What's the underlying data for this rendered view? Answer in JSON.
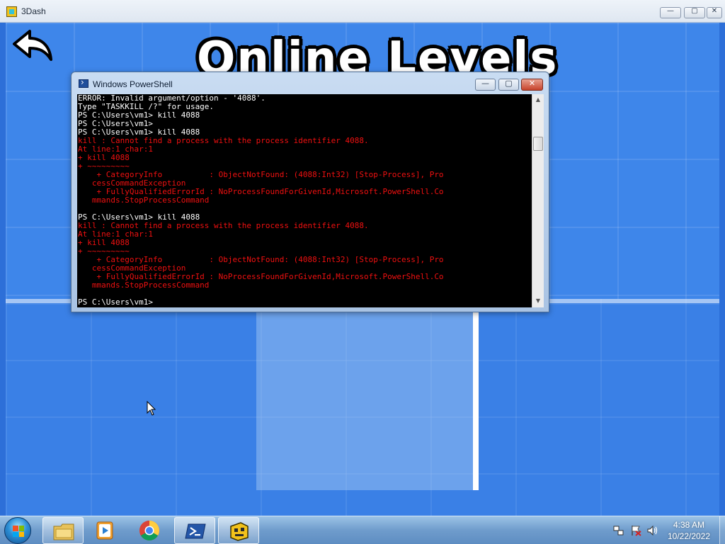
{
  "game": {
    "window_title": "3Dash",
    "heading": "Online Levels",
    "controls": {
      "minimize": "—",
      "maximize": "▢",
      "close": "✕"
    }
  },
  "powershell": {
    "title": "Windows PowerShell",
    "controls": {
      "minimize": "—",
      "maximize": "▢",
      "close": "✕"
    },
    "lines": [
      {
        "text": "ERROR: Invalid argument/option - '4088'.",
        "style": "normal"
      },
      {
        "text": "Type \"TASKKILL /?\" for usage.",
        "style": "normal"
      },
      {
        "text": "PS C:\\Users\\vm1> kill 4088",
        "style": "normal"
      },
      {
        "text": "PS C:\\Users\\vm1>",
        "style": "normal"
      },
      {
        "text": "PS C:\\Users\\vm1> kill 4088",
        "style": "normal"
      },
      {
        "text": "kill : Cannot find a process with the process identifier 4088.",
        "style": "error"
      },
      {
        "text": "At line:1 char:1",
        "style": "error"
      },
      {
        "text": "+ kill 4088",
        "style": "error"
      },
      {
        "text": "+ ~~~~~~~~~",
        "style": "error"
      },
      {
        "text": "    + CategoryInfo          : ObjectNotFound: (4088:Int32) [Stop-Process], Pro",
        "style": "error"
      },
      {
        "text": "   cessCommandException",
        "style": "error"
      },
      {
        "text": "    + FullyQualifiedErrorId : NoProcessFoundForGivenId,Microsoft.PowerShell.Co",
        "style": "error"
      },
      {
        "text": "   mmands.StopProcessCommand",
        "style": "error"
      },
      {
        "text": "",
        "style": "normal"
      },
      {
        "text": "PS C:\\Users\\vm1> kill 4088",
        "style": "normal"
      },
      {
        "text": "kill : Cannot find a process with the process identifier 4088.",
        "style": "error"
      },
      {
        "text": "At line:1 char:1",
        "style": "error"
      },
      {
        "text": "+ kill 4088",
        "style": "error"
      },
      {
        "text": "+ ~~~~~~~~~",
        "style": "error"
      },
      {
        "text": "    + CategoryInfo          : ObjectNotFound: (4088:Int32) [Stop-Process], Pro",
        "style": "error"
      },
      {
        "text": "   cessCommandException",
        "style": "error"
      },
      {
        "text": "    + FullyQualifiedErrorId : NoProcessFoundForGivenId,Microsoft.PowerShell.Co",
        "style": "error"
      },
      {
        "text": "   mmands.StopProcessCommand",
        "style": "error"
      },
      {
        "text": "",
        "style": "normal"
      },
      {
        "text": "PS C:\\Users\\vm1>",
        "style": "normal"
      }
    ],
    "scroll": {
      "up": "▲",
      "down": "▼"
    },
    "colors": {
      "background": "#000000",
      "normal_text": "#ffffff",
      "error_text": "#f01010"
    }
  },
  "taskbar": {
    "items": [
      {
        "name": "Windows Explorer",
        "icon": "folder-icon"
      },
      {
        "name": "Windows Media Player",
        "icon": "media-player-icon"
      },
      {
        "name": "Google Chrome",
        "icon": "chrome-icon"
      },
      {
        "name": "Windows PowerShell",
        "icon": "powershell-icon",
        "active": true
      },
      {
        "name": "3Dash",
        "icon": "3dash-icon",
        "active": true
      }
    ],
    "tray_icons": [
      "network-icon",
      "action-center-icon",
      "volume-icon"
    ],
    "clock": {
      "time": "4:38 AM",
      "date": "10/22/2022"
    }
  }
}
